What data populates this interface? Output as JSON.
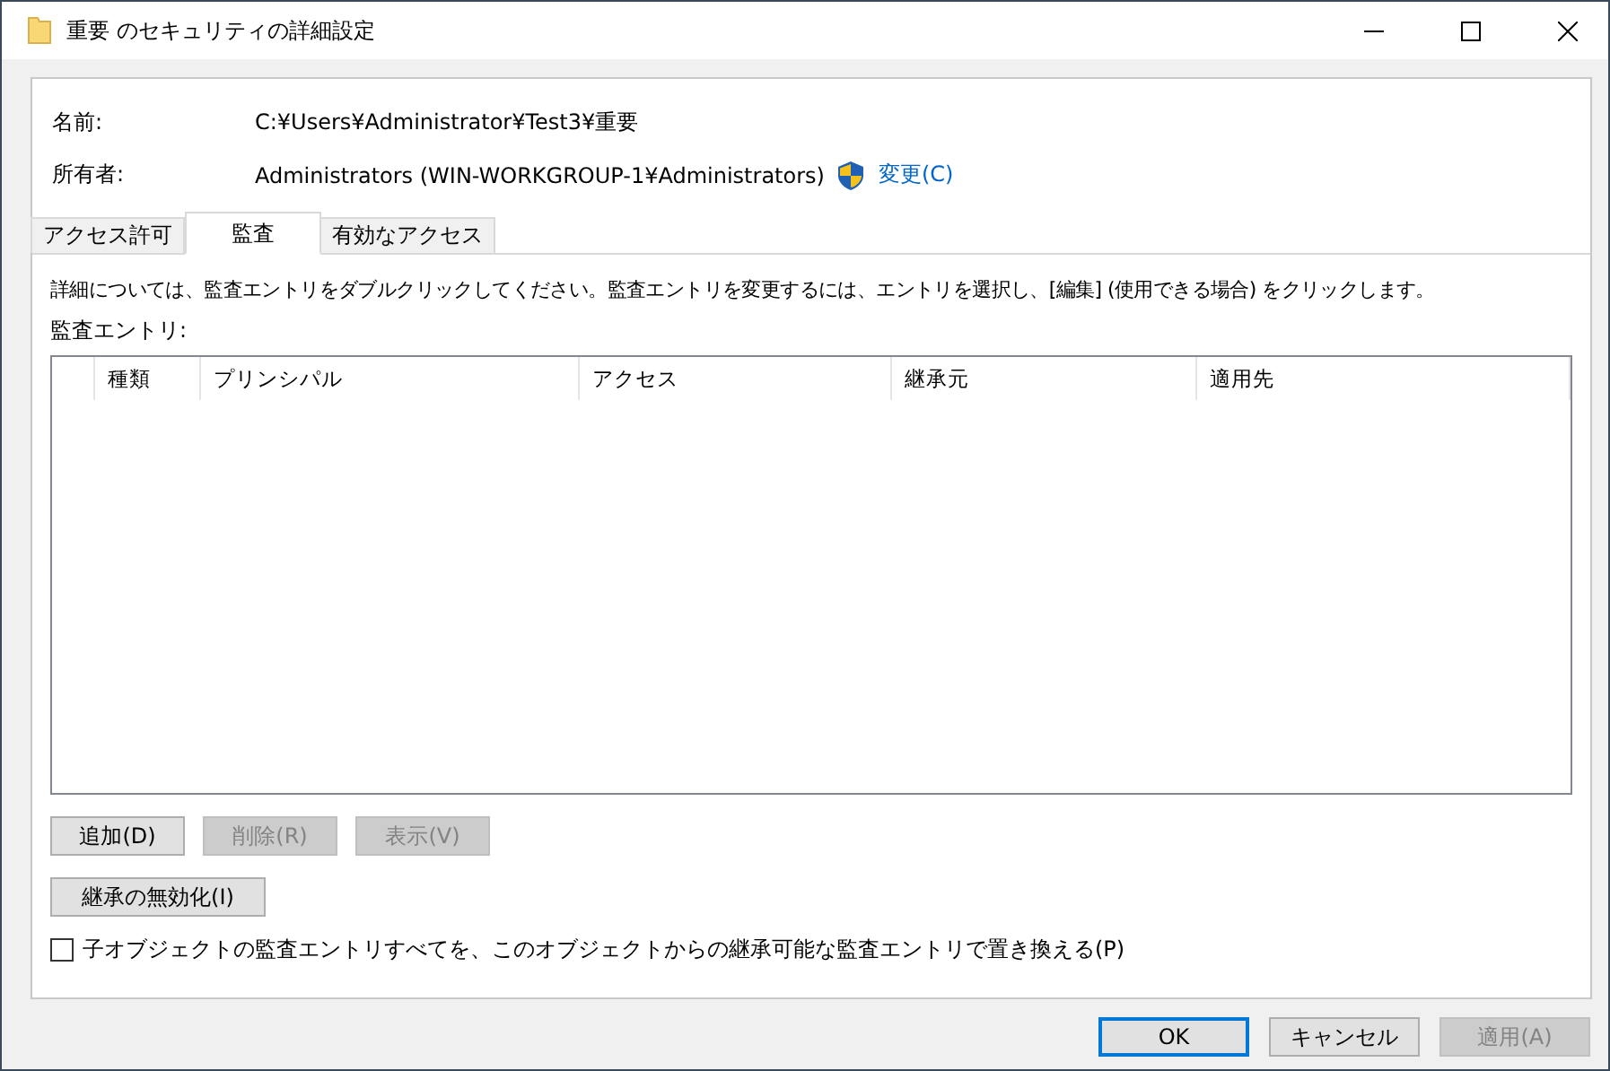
{
  "window": {
    "title": "重要 のセキュリティの詳細設定"
  },
  "info": {
    "name_label": "名前:",
    "name_value": "C:¥Users¥Administrator¥Test3¥重要",
    "owner_label": "所有者:",
    "owner_value": "Administrators (WIN-WORKGROUP-1¥Administrators)",
    "change_link": "変更(C)"
  },
  "tabs": [
    {
      "label": "アクセス許可",
      "selected": false
    },
    {
      "label": "監査",
      "selected": true
    },
    {
      "label": "有効なアクセス",
      "selected": false
    }
  ],
  "description": "詳細については、監査エントリをダブルクリックしてください。監査エントリを変更するには、エントリを選択し、[編集] (使用できる場合) をクリックします。",
  "entries_label": "監査エントリ:",
  "table": {
    "columns": [
      "種類",
      "プリンシパル",
      "アクセス",
      "継承元",
      "適用先"
    ]
  },
  "entry_buttons": [
    {
      "label": "追加(D)",
      "disabled": false
    },
    {
      "label": "削除(R)",
      "disabled": true
    },
    {
      "label": "表示(V)",
      "disabled": true
    }
  ],
  "inherit_button": {
    "label": "継承の無効化(I)",
    "disabled": false
  },
  "replace_checkbox": {
    "label": "子オブジェクトの監査エントリすべてを、このオブジェクトからの継承可能な監査エントリで置き換える(P)",
    "checked": false
  },
  "footer_buttons": [
    {
      "label": "OK",
      "disabled": false,
      "default": true
    },
    {
      "label": "キャンセル",
      "disabled": false,
      "default": false
    },
    {
      "label": "適用(A)",
      "disabled": true,
      "default": false
    }
  ]
}
